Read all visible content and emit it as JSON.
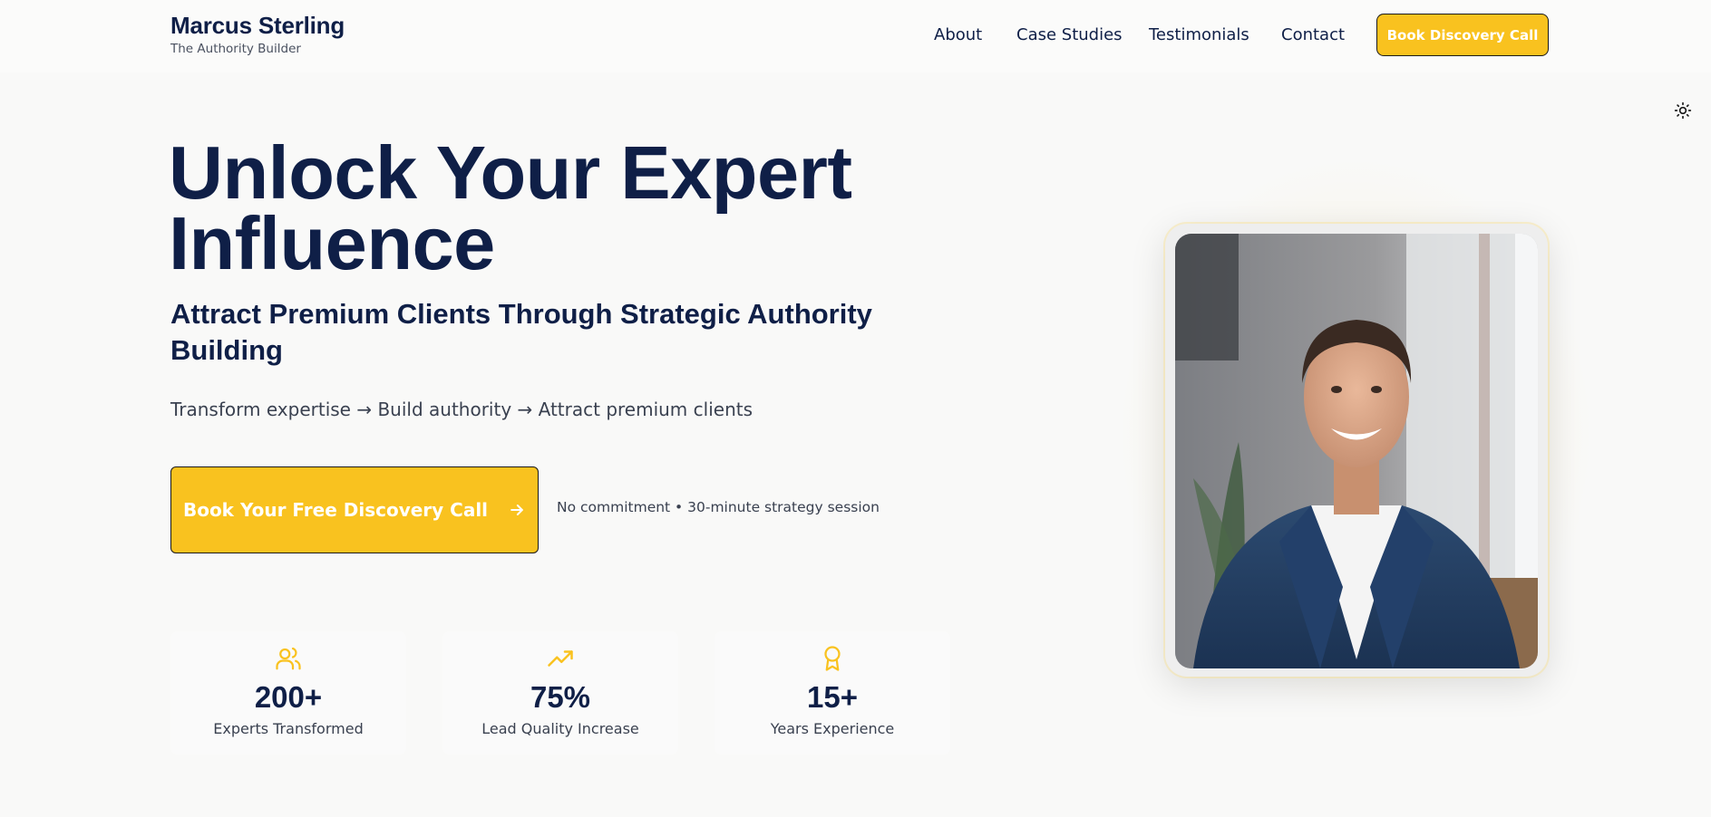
{
  "header": {
    "brand_name": "Marcus Sterling",
    "brand_tagline": "The Authority Builder",
    "nav": [
      {
        "label": "About"
      },
      {
        "label": "Case Studies"
      },
      {
        "label": "Testimonials"
      },
      {
        "label": "Contact"
      }
    ],
    "cta_label": "Book Discovery Call"
  },
  "theme_toggle": {
    "icon": "sun-icon"
  },
  "hero": {
    "title": "Unlock Your Expert Influence",
    "subtitle": "Attract Premium Clients Through Strategic Authority Building",
    "tagline": "Transform expertise → Build authority → Attract premium clients",
    "cta_label": "Book Your Free Discovery Call",
    "cta_icon": "arrow-right-icon",
    "cta_note": "No commitment • 30-minute strategy session"
  },
  "stats": [
    {
      "icon": "users-icon",
      "value": "200+",
      "label": "Experts Transformed"
    },
    {
      "icon": "trending-up-icon",
      "value": "75%",
      "label": "Lead Quality Increase"
    },
    {
      "icon": "award-icon",
      "value": "15+",
      "label": "Years Experience"
    }
  ],
  "colors": {
    "accent": "#f9c21f",
    "navy": "#0f1f47",
    "text_muted": "#3a4150",
    "background": "#f9f9f8"
  }
}
